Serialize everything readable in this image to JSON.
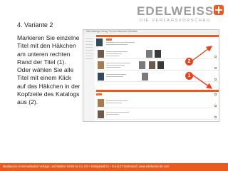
{
  "brand": {
    "name": "EDELWEISS",
    "subtitle": "DIE VERLAGSVORSCHAU",
    "accent_color": "#ea5a1f",
    "icon": "plus-cross-icon"
  },
  "slide": {
    "title": "4. Variante 2",
    "instructions": "Markieren Sie einzelne Titel mit den Häkchen am unteren rechten Rand der Titel (1). Oder wählen Sie alle Titel mit einem Klick auf das Häkchen in der Kopfzeile des Katalogs aus (2)."
  },
  "annotations": {
    "badge_1": "1",
    "badge_2": "2",
    "arrow_color": "#e8431c"
  },
  "screenshot": {
    "nav_text": "Titel  Kataloge  Verlag  Themen  Aktionen  Merkliste"
  },
  "footer": {
    "text": "Mediavoice Kommunikation Verlags- und Medien GmbH & Co. KG • Königswall 21 • D-44137 Dortmund | www.edelweiss-de.com"
  }
}
